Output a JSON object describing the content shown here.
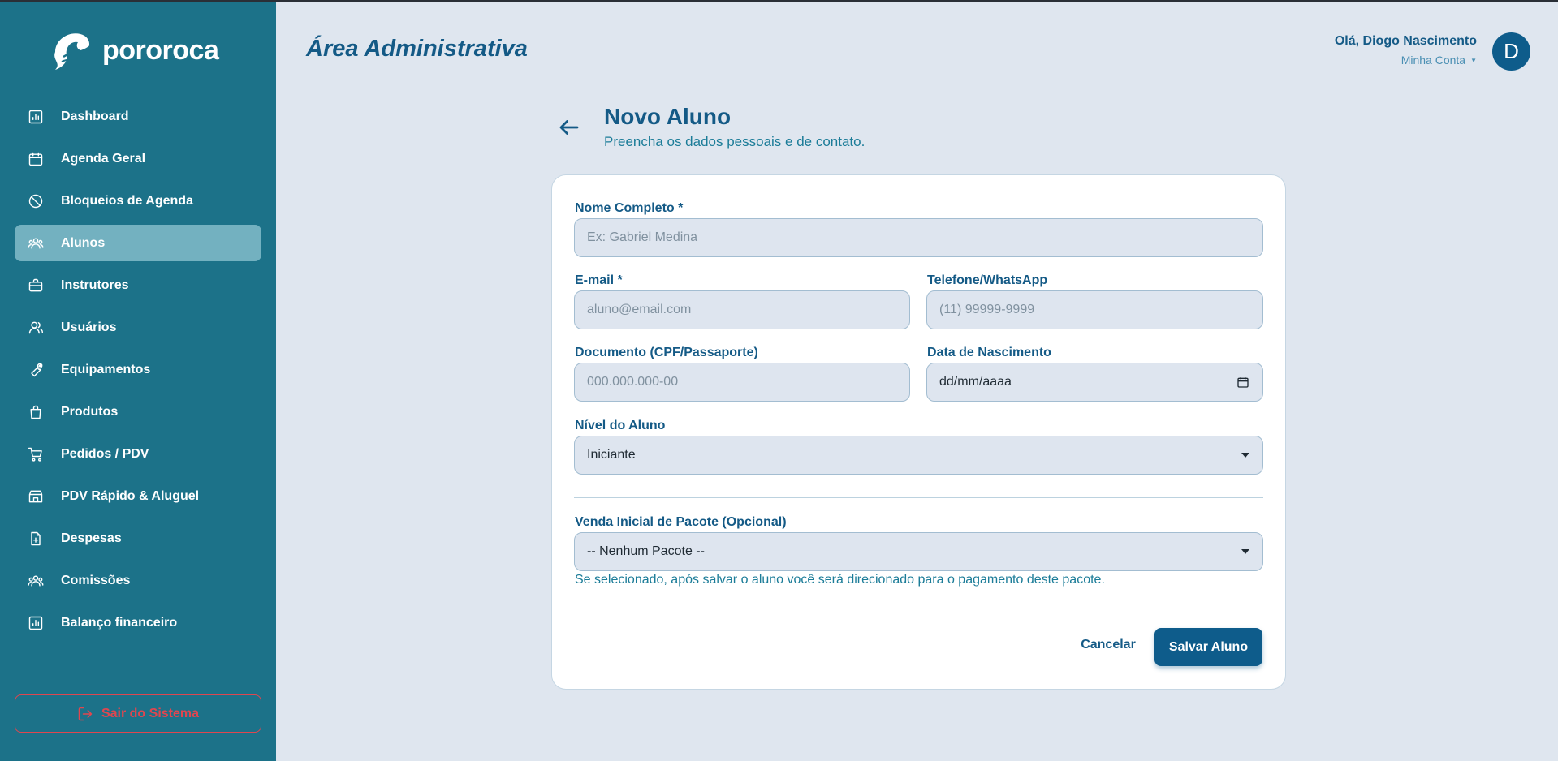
{
  "brand": {
    "name": "pororoca"
  },
  "sidebar": {
    "items": [
      {
        "label": "Dashboard",
        "icon": "chart-bar-icon",
        "active": false
      },
      {
        "label": "Agenda Geral",
        "icon": "calendar-icon",
        "active": false
      },
      {
        "label": "Bloqueios de Agenda",
        "icon": "ban-icon",
        "active": false
      },
      {
        "label": "Alunos",
        "icon": "users-icon",
        "active": true
      },
      {
        "label": "Instrutores",
        "icon": "briefcase-icon",
        "active": false
      },
      {
        "label": "Usuários",
        "icon": "user-group-icon",
        "active": false
      },
      {
        "label": "Equipamentos",
        "icon": "wrench-icon",
        "active": false
      },
      {
        "label": "Produtos",
        "icon": "shopping-bag-icon",
        "active": false
      },
      {
        "label": "Pedidos / PDV",
        "icon": "cart-icon",
        "active": false
      },
      {
        "label": "PDV Rápido & Aluguel",
        "icon": "store-icon",
        "active": false
      },
      {
        "label": "Despesas",
        "icon": "file-plus-icon",
        "active": false
      },
      {
        "label": "Comissões",
        "icon": "users-icon",
        "active": false
      },
      {
        "label": "Balanço financeiro",
        "icon": "chart-bar-icon",
        "active": false
      }
    ],
    "logout_label": "Sair do Sistema"
  },
  "header": {
    "area_title": "Área Administrativa",
    "greeting": "Olá, Diogo Nascimento",
    "account_label": "Minha Conta",
    "avatar_letter": "D"
  },
  "page": {
    "title": "Novo Aluno",
    "subtitle": "Preencha os dados pessoais e de contato."
  },
  "form": {
    "name": {
      "label": "Nome Completo *",
      "placeholder": "Ex: Gabriel Medina"
    },
    "email": {
      "label": "E-mail *",
      "placeholder": "aluno@email.com"
    },
    "phone": {
      "label": "Telefone/WhatsApp",
      "placeholder": "(11) 99999-9999"
    },
    "document": {
      "label": "Documento (CPF/Passaporte)",
      "placeholder": "000.000.000-00"
    },
    "birthdate": {
      "label": "Data de Nascimento",
      "value": "dd/mm/aaaa"
    },
    "level": {
      "label": "Nível do Aluno",
      "value": "Iniciante"
    },
    "package": {
      "label": "Venda Inicial de Pacote (Opcional)",
      "value": "-- Nenhum Pacote --",
      "hint": "Se selecionado, após salvar o aluno você será direcionado para o pagamento deste pacote."
    },
    "cancel_label": "Cancelar",
    "save_label": "Salvar Aluno"
  },
  "colors": {
    "sidebar_bg": "#1c7289",
    "active_item": "#73b1c0",
    "primary": "#0e5c8b",
    "page_bg": "#dfe6ef",
    "danger": "#e0464f"
  }
}
